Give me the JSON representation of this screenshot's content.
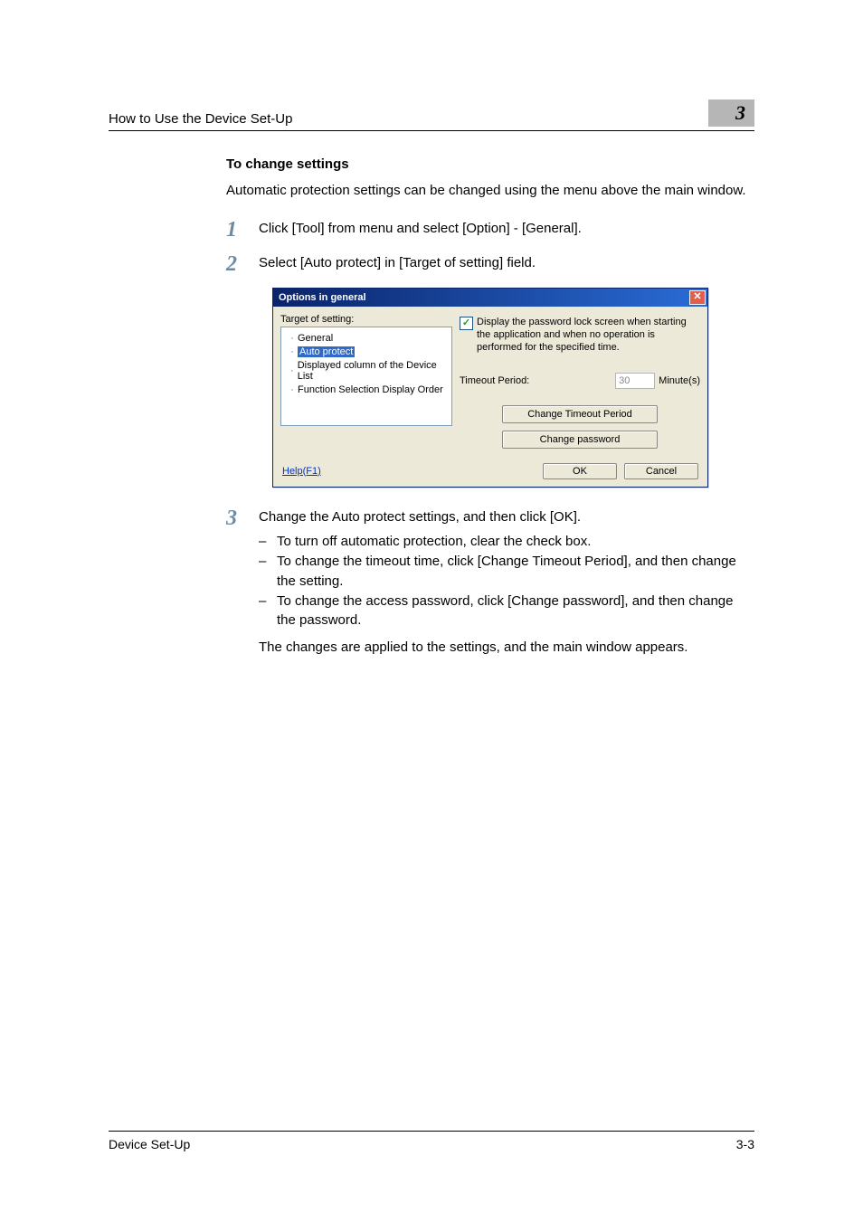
{
  "header": {
    "breadcrumb": "How to Use the Device Set-Up",
    "chapter": "3"
  },
  "section": {
    "title": "To change settings",
    "intro": "Automatic protection settings can be changed using the menu above the main window."
  },
  "steps": {
    "s1": {
      "num": "1",
      "text": "Click [Tool] from menu and select [Option] - [General]."
    },
    "s2": {
      "num": "2",
      "text": "Select [Auto protect] in [Target of setting] field."
    },
    "s3": {
      "num": "3",
      "text": "Change the Auto protect settings, and then click [OK].",
      "bullets": {
        "b1": "To turn off automatic protection, clear the check box.",
        "b2": "To change the timeout time, click [Change Timeout Period], and then change the setting.",
        "b3": "To change the access password, click [Change password], and then change the password."
      },
      "closing": "The changes are applied to the settings, and the main window appears."
    }
  },
  "dialog": {
    "title": "Options in general",
    "close_glyph": "✕",
    "tree_label": "Target of setting:",
    "tree": {
      "item1": "General",
      "item2": "Auto protect",
      "item3": "Displayed column of the Device List",
      "item4": "Function Selection Display Order"
    },
    "checkbox_label": "Display the password lock screen when starting the application and when no operation is performed for the specified time.",
    "check_mark": "✓",
    "timeout_label": "Timeout Period:",
    "timeout_value": "30",
    "timeout_unit": "Minute(s)",
    "btn_change_period": "Change Timeout Period",
    "btn_change_password": "Change password",
    "help": "Help(F1)",
    "ok": "OK",
    "cancel": "Cancel"
  },
  "footer": {
    "product": "Device Set-Up",
    "page": "3-3"
  },
  "glyphs": {
    "dash": "–",
    "tree_dot": "·"
  }
}
